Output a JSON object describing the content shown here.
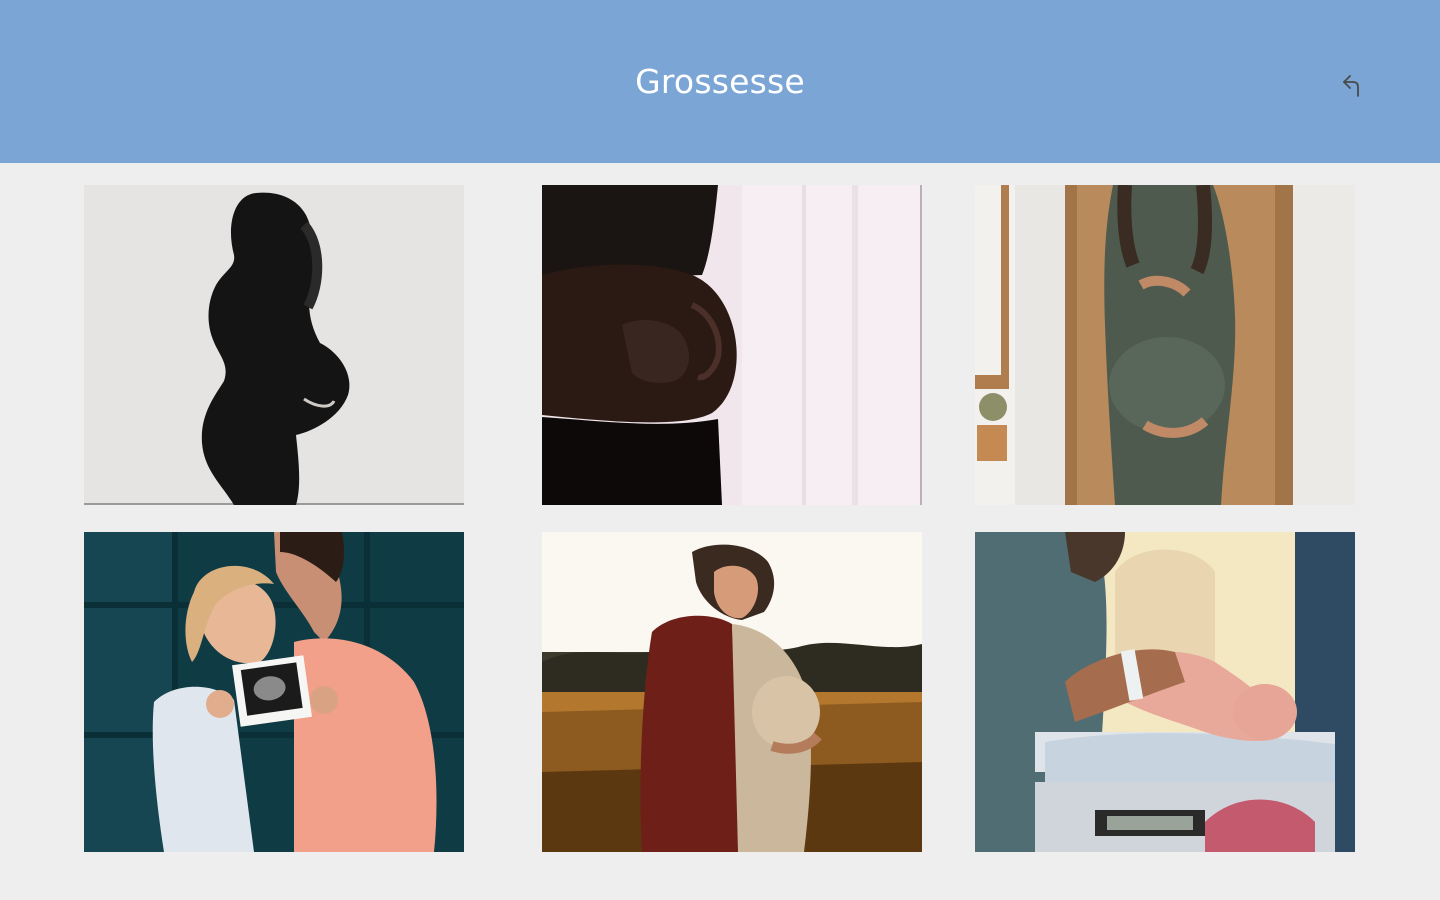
{
  "header": {
    "title": "Grossesse",
    "back_icon": "back-arrow-icon",
    "background_color": "#7aa5d4"
  },
  "gallery": {
    "photos": [
      "silhouette-pregnant-woman-photo",
      "pregnant-belly-hands-photo",
      "pregnant-woman-green-dress-photo",
      "couple-ultrasound-photo",
      "pregnant-woman-field-sunset-photo",
      "newborn-baby-scale-photo"
    ]
  }
}
